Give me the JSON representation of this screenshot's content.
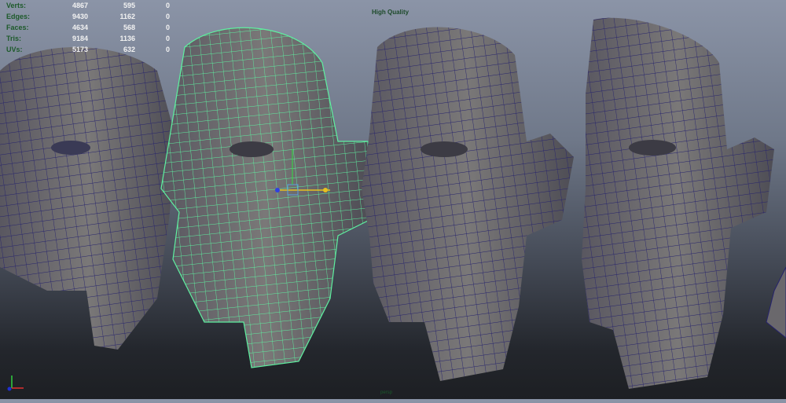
{
  "hud": {
    "rows": [
      {
        "label": "Verts:",
        "values": [
          "4867",
          "595",
          "0"
        ]
      },
      {
        "label": "Edges:",
        "values": [
          "9430",
          "1162",
          "0"
        ]
      },
      {
        "label": "Faces:",
        "values": [
          "4634",
          "568",
          "0"
        ]
      },
      {
        "label": "Tris:",
        "values": [
          "9184",
          "1136",
          "0"
        ]
      },
      {
        "label": "UVs:",
        "values": [
          "5173",
          "632",
          "0"
        ]
      }
    ]
  },
  "viewport": {
    "quality_label": "High Quality",
    "camera_label": "persp"
  },
  "colors": {
    "mesh": "#6d6b6e",
    "wire": "#24206a",
    "selected_wire": "#5ef0a0",
    "hud_label": "#1d5a2a"
  }
}
